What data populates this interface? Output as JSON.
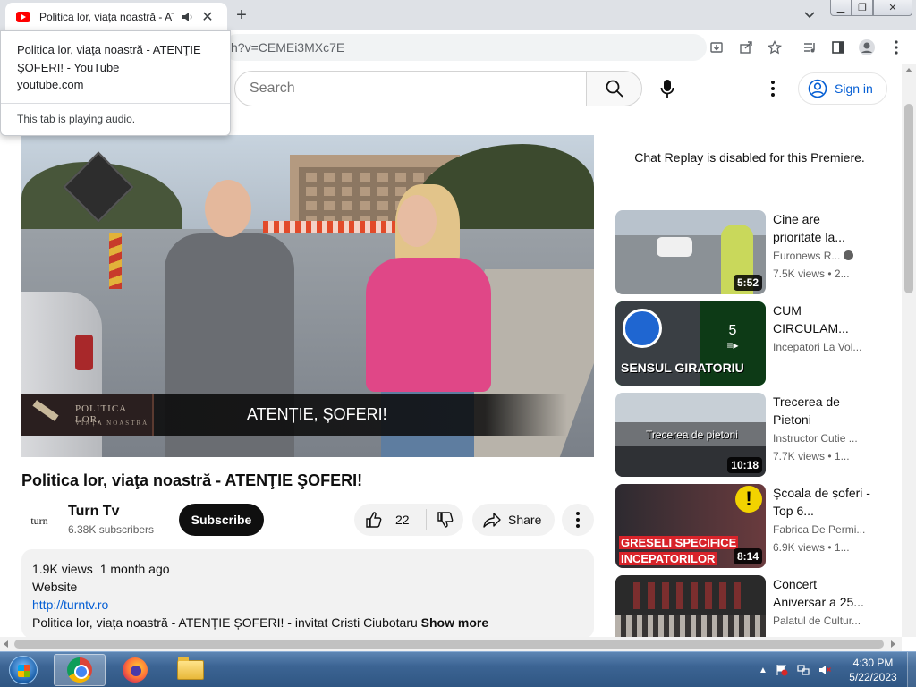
{
  "browser": {
    "tab": {
      "title": "Politica lor, viața noastră - ATENȚIE ȘOFERI! - YouTube"
    },
    "address_visible": "h?v=CEMEi3MXc7E",
    "hover_card": {
      "title": "Politica lor, viaţa noastră - ATENŢIE ŞOFERI! - YouTube",
      "domain": "youtube.com",
      "audio_note": "This tab is playing audio."
    }
  },
  "youtube": {
    "search_placeholder": "Search",
    "sign_in": "Sign in",
    "player": {
      "logo_title": "POLITICA LOR,",
      "logo_subtitle": "VIAȚA NOASTRĂ",
      "caption": "ATENȚIE, ȘOFERI!"
    },
    "video": {
      "title": "Politica lor, viaţa noastră - ATENŢIE ŞOFERI!",
      "channel": "Turn  Tv",
      "channel_avatar_text": "turn",
      "subscribers": "6.38K subscribers",
      "subscribe": "Subscribe",
      "likes": "22",
      "share": "Share"
    },
    "description": {
      "views": "1.9K views",
      "age": "1 month ago",
      "label": "Website",
      "link": "http://turntv.ro",
      "text": "Politica lor, viața noastră - ATENȚIE ȘOFERI! - invitat Cristi Ciubotaru",
      "show_more": "Show more"
    },
    "chat_replay": "Chat Replay is disabled for this Premiere.",
    "recommendations": [
      {
        "title": "Cine are prioritate la...",
        "channel": "Euronews R...",
        "verified": true,
        "meta": "7.5K views  •  2...",
        "duration": "5:52"
      },
      {
        "title": "CUM CIRCULAM...",
        "channel": "Incepatori La Vol...",
        "playlist_count": "5",
        "thumb_text": "SENSUL GIRATORIU",
        "meta": ""
      },
      {
        "title": "Trecerea de Pietoni",
        "channel": "Instructor Cutie ...",
        "meta": "7.7K views  •  1...",
        "duration": "10:18",
        "thumb_text": "Trecerea de pietoni"
      },
      {
        "title": "Școala de șoferi - Top 6...",
        "channel": "Fabrica De Permi...",
        "meta": "6.9K views  •  1...",
        "duration": "8:14",
        "thumb_text_1": "GRESELI SPECIFICE",
        "thumb_text_2": "INCEPATORILOR"
      },
      {
        "title": "Concert Aniversar a 25...",
        "channel": "Palatul de Cultur...",
        "meta": ""
      }
    ]
  },
  "taskbar": {
    "time": "4:30 PM",
    "date": "5/22/2023"
  },
  "colors": {
    "accent_link": "#065fd4",
    "subscribe_bg": "#0f0f0f",
    "youtube_red": "#ff0000",
    "tabstrip": "#dee1e6"
  }
}
